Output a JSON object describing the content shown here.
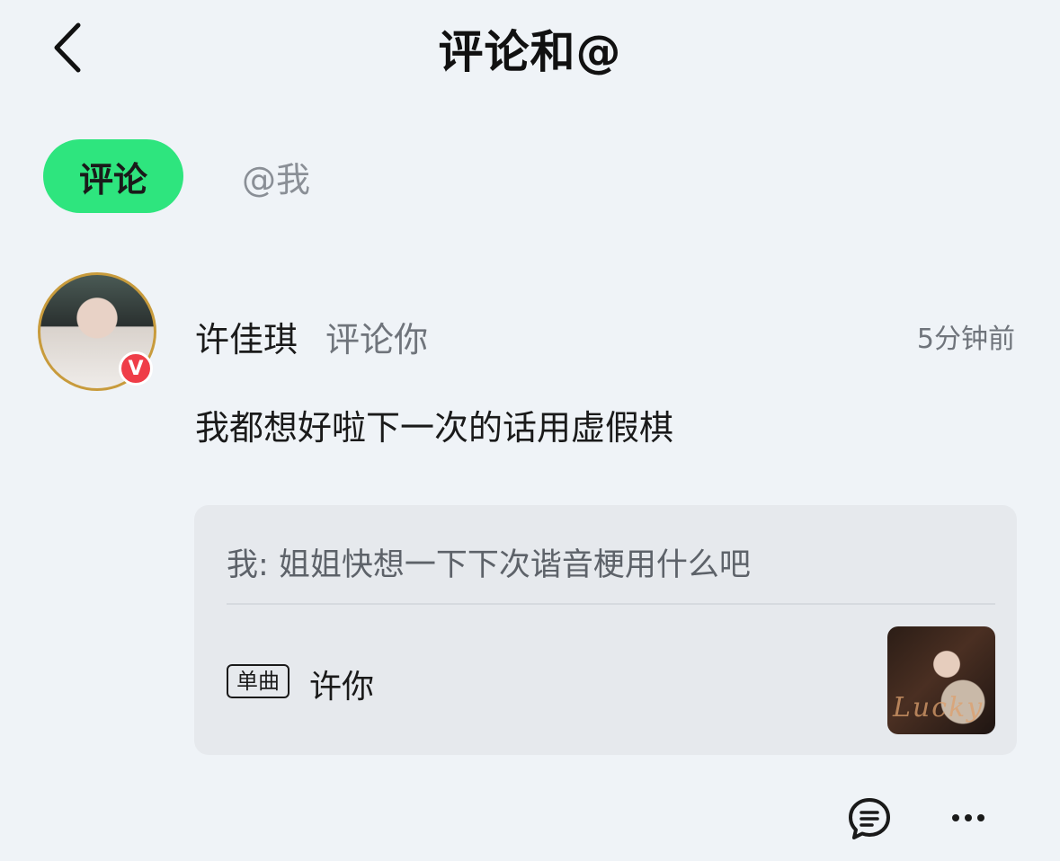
{
  "header": {
    "title": "评论和@",
    "back_icon": "chevron-left-icon"
  },
  "tabs": [
    {
      "label": "评论",
      "active": true
    },
    {
      "label": "@我",
      "active": false
    }
  ],
  "colors": {
    "accent": "#2ee57e",
    "badge": "#ef3d48",
    "avatar_ring": "#c89b3c"
  },
  "notification": {
    "user_name": "许佳琪",
    "action": "评论你",
    "time": "5分钟前",
    "verified_badge": "V",
    "comment": "我都想好啦下一次的话用虚假棋",
    "quote": "我: 姐姐快想一下下次谐音梗用什么吧",
    "song": {
      "tag": "单曲",
      "title": "许你"
    }
  },
  "actions": {
    "reply_icon": "comment-icon",
    "more_icon": "more-dots-icon"
  }
}
